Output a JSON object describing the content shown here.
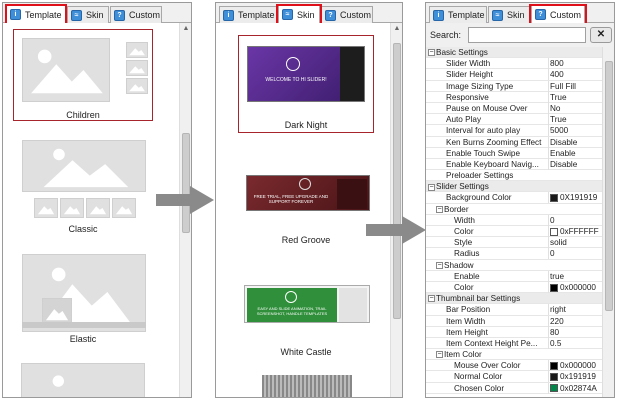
{
  "panels": {
    "template_panel": {
      "tabs": [
        {
          "label": "Template"
        },
        {
          "label": "Skin"
        },
        {
          "label": "Custom"
        }
      ],
      "active_tab": "Template",
      "items": [
        {
          "label": "Children",
          "selected": true
        },
        {
          "label": "Classic",
          "selected": false
        },
        {
          "label": "Elastic",
          "selected": false
        }
      ]
    },
    "skin_panel": {
      "tabs": [
        {
          "label": "Template"
        },
        {
          "label": "Skin"
        },
        {
          "label": "Custom"
        }
      ],
      "active_tab": "Skin",
      "items": [
        {
          "label": "Dark Night",
          "selected": true,
          "color": "#5a2a8a",
          "banner": "WELCOME TO HI SLIDER!"
        },
        {
          "label": "Red Groove",
          "selected": false,
          "color": "#6a1f24",
          "banner": "FREE TRIAL, FREE UPGRADE AND SUPPORT FOREVER"
        },
        {
          "label": "White Castle",
          "selected": false,
          "color": "#2f8f3a",
          "banner": "EASY AND SLIDE ANIMATION, TRAIL SCREENSHOT, HANDLE TEMPLATES"
        }
      ]
    },
    "custom_panel": {
      "tabs": [
        {
          "label": "Template"
        },
        {
          "label": "Skin"
        },
        {
          "label": "Custom"
        }
      ],
      "active_tab": "Custom",
      "search_label": "Search:",
      "search_value": "",
      "clear_label": "✕"
    }
  },
  "properties": [
    {
      "name": "Basic Settings",
      "value": "",
      "level": 0,
      "category": true
    },
    {
      "name": "Slider Width",
      "value": "800",
      "level": 2
    },
    {
      "name": "Slider Height",
      "value": "400",
      "level": 2
    },
    {
      "name": "Image Sizing Type",
      "value": "Full Fill",
      "level": 2
    },
    {
      "name": "Responsive",
      "value": "True",
      "level": 2
    },
    {
      "name": "Pause on Mouse Over",
      "value": "No",
      "level": 2
    },
    {
      "name": "Auto Play",
      "value": "True",
      "level": 2
    },
    {
      "name": "Interval for auto play",
      "value": "5000",
      "level": 2
    },
    {
      "name": "Ken Burns Zooming Effect",
      "value": "Disable",
      "level": 2
    },
    {
      "name": "Enable Touch Swipe",
      "value": "Enable",
      "level": 2
    },
    {
      "name": "Enable Keyboard Navig...",
      "value": "Disable",
      "level": 2
    },
    {
      "name": "Preloader Settings",
      "value": "",
      "level": 2
    },
    {
      "name": "Slider Settings",
      "value": "",
      "level": 0,
      "category": true
    },
    {
      "name": "Background Color",
      "value": "0X191919",
      "level": 2,
      "swatch": "#191919"
    },
    {
      "name": "Border",
      "value": "",
      "level": 1,
      "category": true
    },
    {
      "name": "Width",
      "value": "0",
      "level": 3
    },
    {
      "name": "Color",
      "value": "0xFFFFFF",
      "level": 3,
      "swatch": "#ffffff"
    },
    {
      "name": "Style",
      "value": "solid",
      "level": 3
    },
    {
      "name": "Radius",
      "value": "0",
      "level": 3
    },
    {
      "name": "Shadow",
      "value": "",
      "level": 1,
      "category": true
    },
    {
      "name": "Enable",
      "value": "true",
      "level": 3
    },
    {
      "name": "Color",
      "value": "0x000000",
      "level": 3,
      "swatch": "#000000"
    },
    {
      "name": "Thumbnail bar Settings",
      "value": "",
      "level": 0,
      "category": true
    },
    {
      "name": "Bar Position",
      "value": "right",
      "level": 2
    },
    {
      "name": "Item Width",
      "value": "220",
      "level": 2
    },
    {
      "name": "Item Height",
      "value": "80",
      "level": 2
    },
    {
      "name": "Item Context Height Pe...",
      "value": "0.5",
      "level": 2
    },
    {
      "name": "Item Color",
      "value": "",
      "level": 1,
      "category": true
    },
    {
      "name": "Mouse Over Color",
      "value": "0x000000",
      "level": 3,
      "swatch": "#000000"
    },
    {
      "name": "Normal Color",
      "value": "0x191919",
      "level": 3,
      "swatch": "#191919"
    },
    {
      "name": "Chosen Color",
      "value": "0x02874A",
      "level": 3,
      "swatch": "#02874a"
    }
  ],
  "colors": {
    "highlight_red": "#e0101a",
    "selected_border": "#a8242c",
    "arrow_gray": "#8a8a8a",
    "tab_icon_blue": "#3e8ed8"
  }
}
